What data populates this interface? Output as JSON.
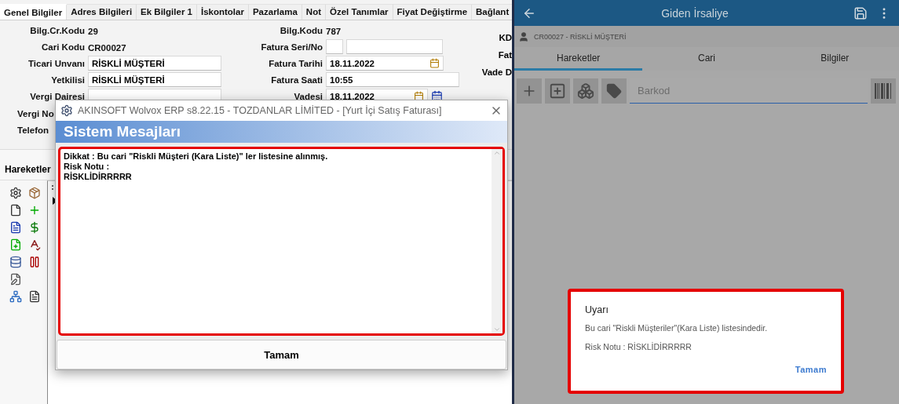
{
  "erp": {
    "tabs": [
      {
        "label": "Genel Bilgiler",
        "selected": true
      },
      {
        "label": "Adres Bilgileri",
        "selected": false
      },
      {
        "label": "Ek Bilgiler 1",
        "selected": false
      },
      {
        "label": "İskontolar",
        "selected": false
      },
      {
        "label": "Pazarlama",
        "selected": false
      },
      {
        "label": "Not",
        "selected": false
      },
      {
        "label": "Özel Tanımlar",
        "selected": false
      },
      {
        "label": "Fiyat Değiştirme",
        "selected": false
      },
      {
        "label": "Bağlant",
        "selected": false
      }
    ],
    "form_left": [
      {
        "kind": "text",
        "label": "Bilg.Cr.Kodu",
        "value": "29"
      },
      {
        "kind": "text",
        "label": "Cari Kodu",
        "value": "CR00027"
      },
      {
        "kind": "field",
        "label": "Ticari Unvanı",
        "value": "RİSKLİ MÜŞTERİ"
      },
      {
        "kind": "field",
        "label": "Yetkilisi",
        "value": "RİSKLİ MÜŞTERİ"
      },
      {
        "kind": "field",
        "label": "Vergi Dairesi"
      },
      {
        "kind": "cut",
        "label": "Vergi No"
      },
      {
        "kind": "cut",
        "label": "Telefon"
      }
    ],
    "form_right": [
      {
        "kind": "text",
        "label": "Bilg.Kodu",
        "value": "787"
      },
      {
        "kind": "serial",
        "label": "Fatura Seri/No"
      },
      {
        "kind": "date",
        "label": "Fatura Tarihi",
        "value": "18.11.2022"
      },
      {
        "kind": "field",
        "label": "Fatura Saati",
        "value": "10:55"
      },
      {
        "kind": "date2",
        "label": "Vadesi",
        "value": "18.11.2022"
      }
    ],
    "far_labels": [
      "KD",
      "Fat",
      "Vade D"
    ],
    "movements_label": "Hareketler",
    "dialog": {
      "window_title": "AKINSOFT Wolvox ERP s8.22.15 - TOZDANLAR LİMİTED - [Yurt İçi Satış Faturası]",
      "header": "Sistem Mesajları",
      "message_lines": [
        "Dikkat : Bu cari \"Riskli Müşteri (Kara Liste)\" ler listesine alınmış.",
        "Risk Notu :",
        "RİSKLİDİRRRRR"
      ],
      "button": "Tamam"
    }
  },
  "mobile": {
    "title": "Giden İrsaliye",
    "customer": "CR00027 - RİSKLİ MÜŞTERİ",
    "tabs": [
      {
        "label": "Hareketler",
        "selected": true
      },
      {
        "label": "Cari",
        "selected": false
      },
      {
        "label": "Bilgiler",
        "selected": false
      }
    ],
    "barcode_placeholder": "Barkod",
    "dialog": {
      "title": "Uyarı",
      "message": "Bu cari \"Riskli Müşteriler\"(Kara Liste) listesindedir.",
      "note": "Risk Notu : RİSKLİDİRRRRR",
      "button": "Tamam"
    }
  }
}
